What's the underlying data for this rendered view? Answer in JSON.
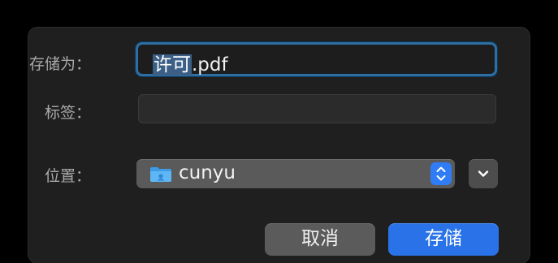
{
  "dialog": {
    "save_as_label": "存储为：",
    "file_name": {
      "selected_part": "许可",
      "unselected_part": ".pdf"
    },
    "tags_label": "标签：",
    "tags_value": "",
    "location_label": "位置：",
    "location_value": "cunyu",
    "location_icon": "folder-icon",
    "expand_icon": "chevron-down-icon",
    "cancel_label": "取消",
    "save_label": "存储"
  },
  "colors": {
    "accent": "#2A72E8",
    "focus_ring": "#2F6EA3",
    "selection": "#3B5F86"
  }
}
